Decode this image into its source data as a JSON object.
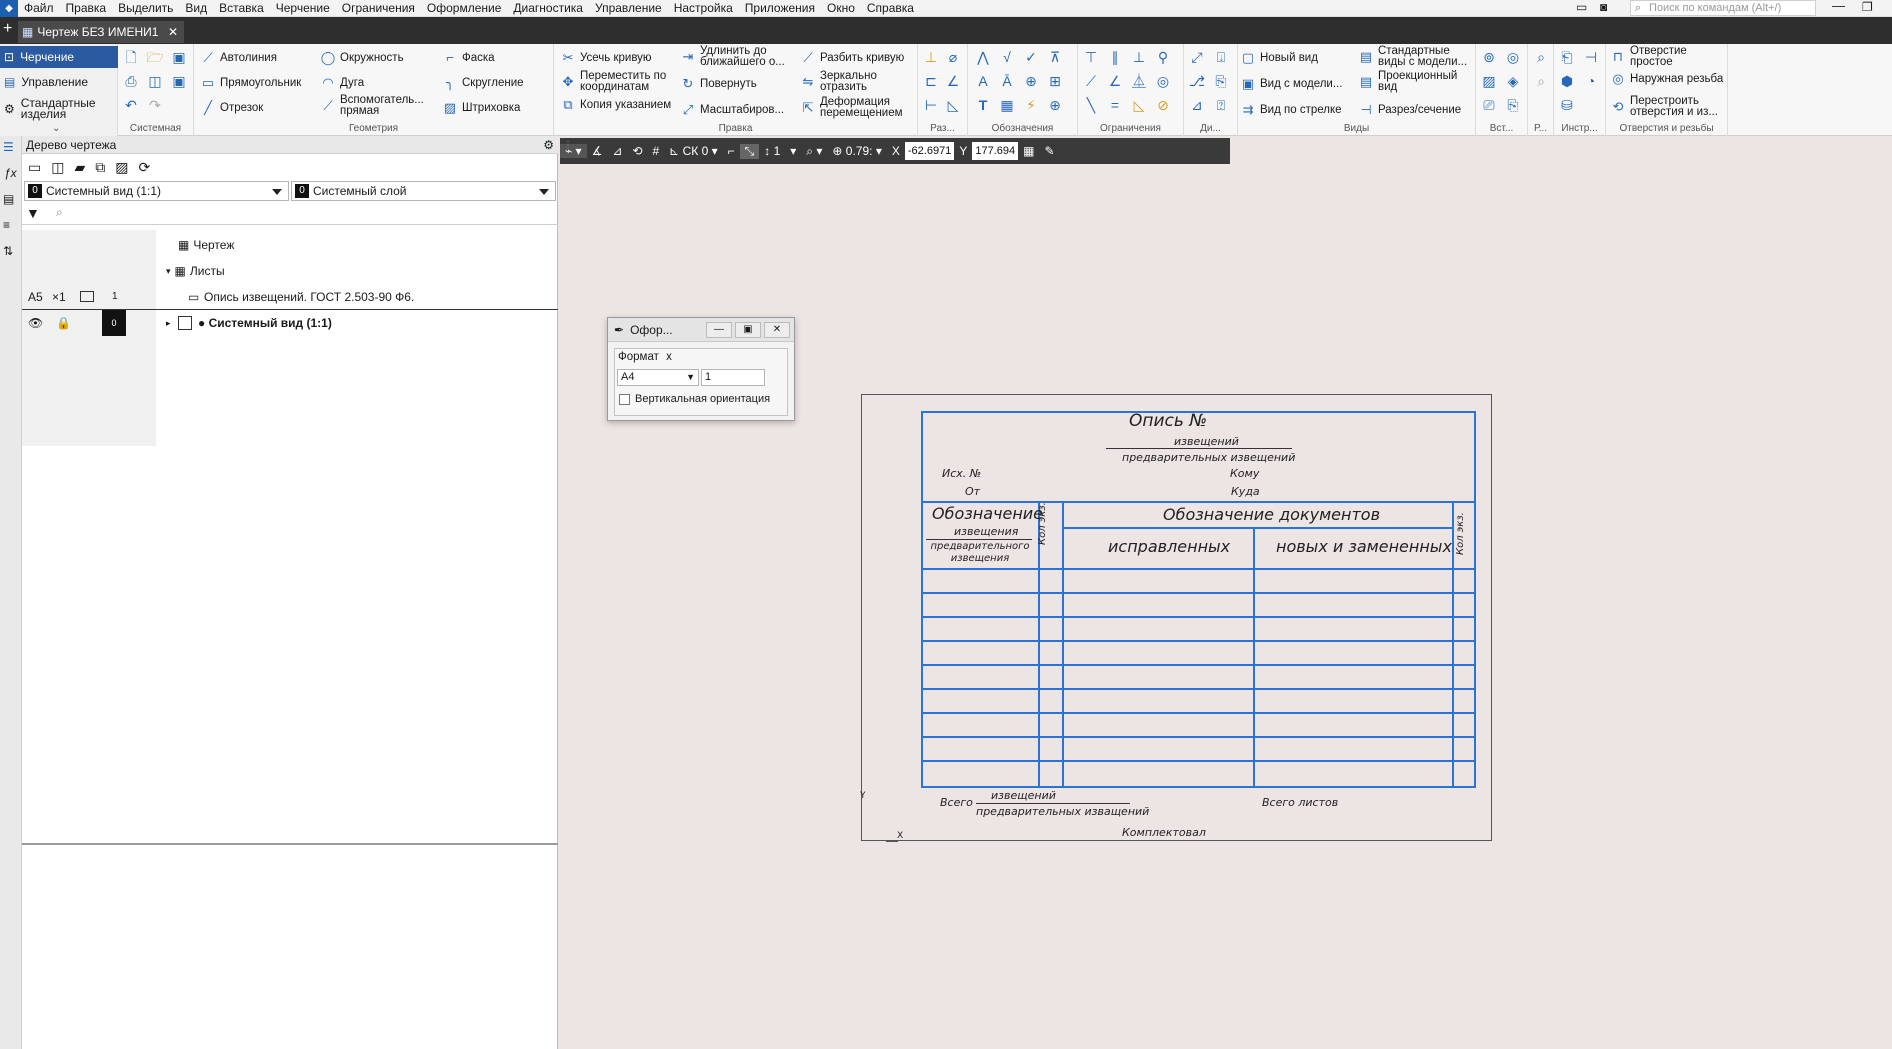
{
  "menu": [
    "Файл",
    "Правка",
    "Выделить",
    "Вид",
    "Вставка",
    "Черчение",
    "Ограничения",
    "Оформление",
    "Диагностика",
    "Управление",
    "Настройка",
    "Приложения",
    "Окно",
    "Справка"
  ],
  "command_search_placeholder": "Поиск по командам (Alt+/)",
  "document_tab": "Чертеж БЕЗ ИМЕНИ1",
  "modes": [
    "Черчение",
    "Управление",
    "Стандартные изделия"
  ],
  "ribbon": {
    "system": {
      "label": "Системная"
    },
    "geometry": {
      "label": "Геометрия",
      "items": [
        "Автолиния",
        "Окружность",
        "Фаска",
        "Прямоугольник",
        "Дуга",
        "Скругление",
        "Отрезок",
        "Вспомогатель... прямая",
        "Штриховка"
      ]
    },
    "edit": {
      "label": "Правка",
      "items": [
        "Усечь кривую",
        "Удлинить до ближайшего о...",
        "Разбить кривую",
        "Переместить по координатам",
        "Повернуть",
        "Зеркально отразить",
        "Копия указанием",
        "Масштабиров...",
        "Деформация перемещением"
      ]
    },
    "small_groups": [
      "Раз...",
      "Обозначения",
      "Ограничения",
      "Ди...",
      "Вст...",
      "Р...",
      "Инстр..."
    ],
    "views": {
      "label": "Виды",
      "items": [
        "Новый вид",
        "Стандартные виды с модели...",
        "Вид с модели...",
        "Проекционный вид",
        "Вид по стрелке",
        "Разрез/сечение"
      ]
    },
    "holes": {
      "label": "Отверстия и резьбы",
      "items": [
        "Отверстие простое",
        "Наружная резьба",
        "Перестроить отверстия и из..."
      ]
    }
  },
  "tree": {
    "title": "Дерево чертежа",
    "view_select": {
      "num": "0",
      "value": "Системный вид (1:1)"
    },
    "layer_select": {
      "num": "0",
      "value": "Системный слой"
    },
    "rows": {
      "drawing": "Чертеж",
      "sheets": "Листы",
      "sheet_format": "А5",
      "sheet_mult": "×1",
      "sheet_num": "1",
      "sheet_name": "Опись извещений. ГОСТ 2.503-90 Ф6.",
      "view_num": "0",
      "view_name": "● Системный вид (1:1)"
    }
  },
  "canvas_toolbar": {
    "cs": "СК 0",
    "layer": "1",
    "zoom": "0.79:",
    "x_label": "X",
    "x": "-62.6971",
    "y_label": "Y",
    "y": "177.694"
  },
  "dialog": {
    "title": "Офор...",
    "section": "Формат",
    "section_close": "x",
    "format": "А4",
    "multiplier": "1",
    "vertical_label": "Вертикальная ориентация"
  },
  "sheet": {
    "title": "Опись №",
    "sub1": "извещений",
    "sub2": "предварительных извещений",
    "ish": "Исх. №",
    "ot": "От",
    "komu": "Кому",
    "kuda": "Куда",
    "col_designation": "Обозначение",
    "col_des_sub1": "извещения",
    "col_des_sub2": "предварительного извещения",
    "col_qty": "Кол экз.",
    "col_docs": "Обозначение документов",
    "col_fixed": "исправленных",
    "col_new": "новых и замененных",
    "total": "Всего",
    "total_sub1": "извещений",
    "total_sub2": "предварительных изващений",
    "total_sheets": "Всего листов",
    "komplekt": "Комплектовал",
    "axis_x": "X",
    "axis_y": "Y"
  },
  "colors": {
    "accent": "#2c5aa0",
    "frame": "#2b74d6",
    "canvas": "#ede5e3"
  }
}
